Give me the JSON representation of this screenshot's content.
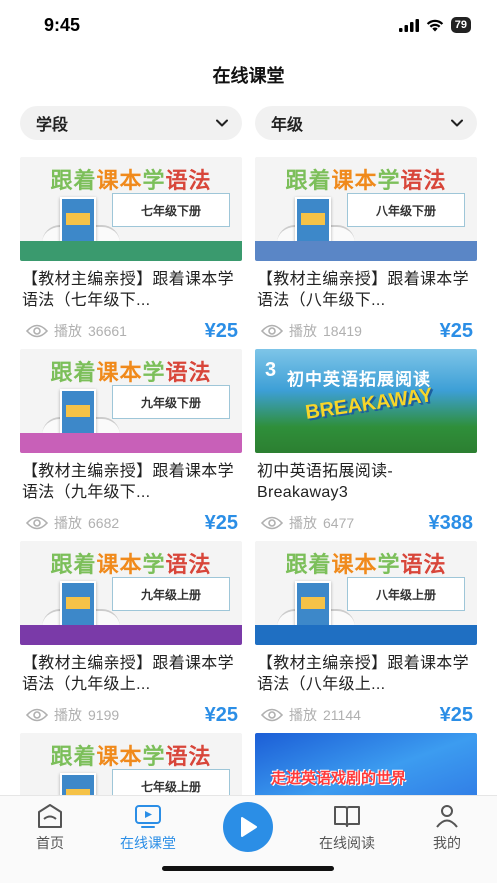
{
  "status": {
    "time": "9:45",
    "battery": "79"
  },
  "header": {
    "title": "在线课堂"
  },
  "filters": {
    "stage": "学段",
    "grade": "年级"
  },
  "colors": {
    "accent": "#2b8ee6",
    "muted": "#b0b0b0"
  },
  "courses": [
    {
      "kind": "grammar",
      "thumb_title": [
        "跟着",
        "课本",
        "学",
        "语法"
      ],
      "grade_label": "七年级下册",
      "band_color": "#3a9a6e",
      "title": "【教材主编亲授】跟着课本学语法（七年级下...",
      "play_label": "播放",
      "plays": "36661",
      "price": "¥25"
    },
    {
      "kind": "grammar",
      "thumb_title": [
        "跟着",
        "课本",
        "学",
        "语法"
      ],
      "grade_label": "八年级下册",
      "band_color": "#5a86c6",
      "title": "【教材主编亲授】跟着课本学语法（八年级下...",
      "play_label": "播放",
      "plays": "18419",
      "price": "¥25"
    },
    {
      "kind": "grammar",
      "thumb_title": [
        "跟着",
        "课本",
        "学",
        "语法"
      ],
      "grade_label": "九年级下册",
      "band_color": "#c860b8",
      "title": "【教材主编亲授】跟着课本学语法（九年级下...",
      "play_label": "播放",
      "plays": "6682",
      "price": "¥25"
    },
    {
      "kind": "breakaway",
      "thumb_num": "3",
      "thumb_title": "初中英语拓展阅读",
      "thumb_word": "BREAKAWAY",
      "title": "初中英语拓展阅读-Breakaway3",
      "play_label": "播放",
      "plays": "6477",
      "price": "¥388"
    },
    {
      "kind": "grammar",
      "thumb_title": [
        "跟着",
        "课本",
        "学",
        "语法"
      ],
      "grade_label": "九年级上册",
      "band_color": "#7a3aa8",
      "title": "【教材主编亲授】跟着课本学语法（九年级上...",
      "play_label": "播放",
      "plays": "9199",
      "price": "¥25"
    },
    {
      "kind": "grammar",
      "thumb_title": [
        "跟着",
        "课本",
        "学",
        "语法"
      ],
      "grade_label": "八年级上册",
      "band_color": "#1f6fc2",
      "title": "【教材主编亲授】跟着课本学语法（八年级上...",
      "play_label": "播放",
      "plays": "21144",
      "price": "¥25"
    },
    {
      "kind": "grammar",
      "thumb_title": [
        "跟着",
        "课本",
        "学",
        "语法"
      ],
      "grade_label": "七年级上册",
      "band_color": "#2fa0c8",
      "title": "",
      "play_label": "",
      "plays": "",
      "price": ""
    },
    {
      "kind": "drama",
      "thumb_title": "走进英语戏剧的世界",
      "title": "",
      "play_label": "",
      "plays": "",
      "price": ""
    }
  ],
  "tabs": [
    {
      "label": "首页",
      "icon": "home-icon"
    },
    {
      "label": "在线课堂",
      "icon": "video-icon",
      "active": true
    },
    {
      "label": "",
      "icon": "play-icon"
    },
    {
      "label": "在线阅读",
      "icon": "reading-icon"
    },
    {
      "label": "我的",
      "icon": "profile-icon"
    }
  ]
}
